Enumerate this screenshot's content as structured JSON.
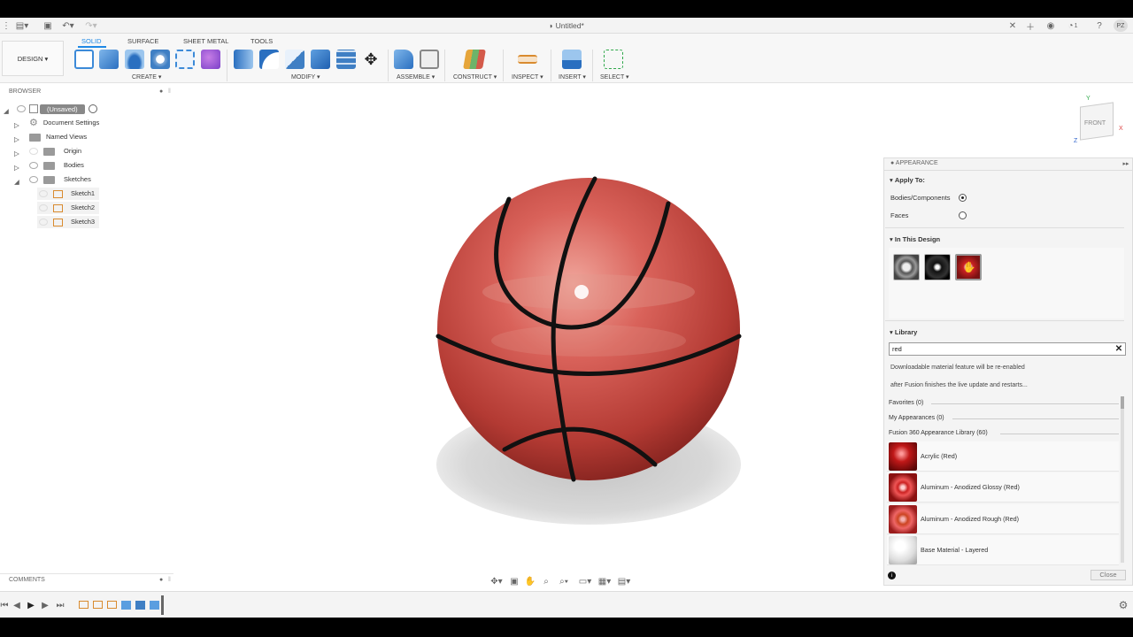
{
  "window": {
    "title": "Untitled*",
    "user_initials": "PZ",
    "job_count": "1"
  },
  "toolbar": {
    "workspace": "DESIGN",
    "tabs": [
      "SOLID",
      "SURFACE",
      "SHEET METAL",
      "TOOLS"
    ],
    "groups": {
      "create": "CREATE",
      "modify": "MODIFY",
      "assemble": "ASSEMBLE",
      "construct": "CONSTRUCT",
      "inspect": "INSPECT",
      "insert": "INSERT",
      "select": "SELECT"
    }
  },
  "browser": {
    "header": "BROWSER",
    "root": "(Unsaved)",
    "items": [
      "Document Settings",
      "Named Views",
      "Origin",
      "Bodies",
      "Sketches"
    ],
    "sketches": [
      "Sketch1",
      "Sketch2",
      "Sketch3"
    ],
    "comments": "COMMENTS"
  },
  "viewcube": {
    "face": "FRONT",
    "x": "X",
    "y": "Y",
    "z": "Z"
  },
  "appearance": {
    "title": "APPEARANCE",
    "apply_to_label": "Apply To:",
    "options": [
      "Bodies/Components",
      "Faces"
    ],
    "selected_option": "Bodies/Components",
    "in_this_design": "In This Design",
    "library_label": "Library",
    "search_value": "red",
    "notice_line1": "Downloadable material feature will be re-enabled",
    "notice_line2": "after Fusion finishes the live update and restarts...",
    "categories": [
      "Favorites (0)",
      "My Appearances (0)",
      "Fusion 360 Appearance Library (60)"
    ],
    "library_items": [
      "Acrylic (Red)",
      "Aluminum - Anodized Glossy (Red)",
      "Aluminum - Anodized Rough (Red)",
      "Base Material - Layered"
    ],
    "close_label": "Close"
  },
  "colors": {
    "accent": "#1e88e5",
    "ball_red": "#c8473f",
    "seam": "#111111"
  }
}
